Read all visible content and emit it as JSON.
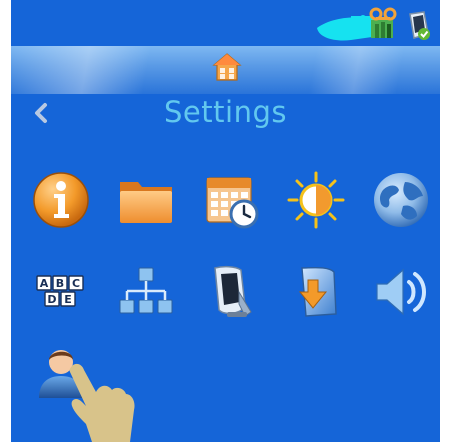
{
  "header": {
    "title": "Settings"
  },
  "navigation": {
    "home_icon": "home-icon",
    "back_icon": "chevron-left-icon"
  },
  "status_bar": {
    "icons": [
      "voicemail-icon",
      "device-status-icon"
    ]
  },
  "settings_icons": [
    {
      "name": "info",
      "icon": "info-icon"
    },
    {
      "name": "folder",
      "icon": "folder-icon"
    },
    {
      "name": "date-time",
      "icon": "calendar-clock-icon"
    },
    {
      "name": "brightness",
      "icon": "brightness-icon"
    },
    {
      "name": "globe",
      "icon": "globe-icon"
    },
    {
      "name": "keyboard",
      "icon": "abcde-keyboard-icon"
    },
    {
      "name": "network",
      "icon": "network-icon"
    },
    {
      "name": "handset",
      "icon": "handset-icon"
    },
    {
      "name": "update",
      "icon": "download-update-icon"
    },
    {
      "name": "sound",
      "icon": "speaker-icon"
    },
    {
      "name": "user",
      "icon": "user-icon"
    }
  ],
  "colors": {
    "screen_background": "#1565d8",
    "title_text": "#62c8ef",
    "icon_orange": "#f29a2e",
    "touch_hand": "#d8c38a"
  }
}
